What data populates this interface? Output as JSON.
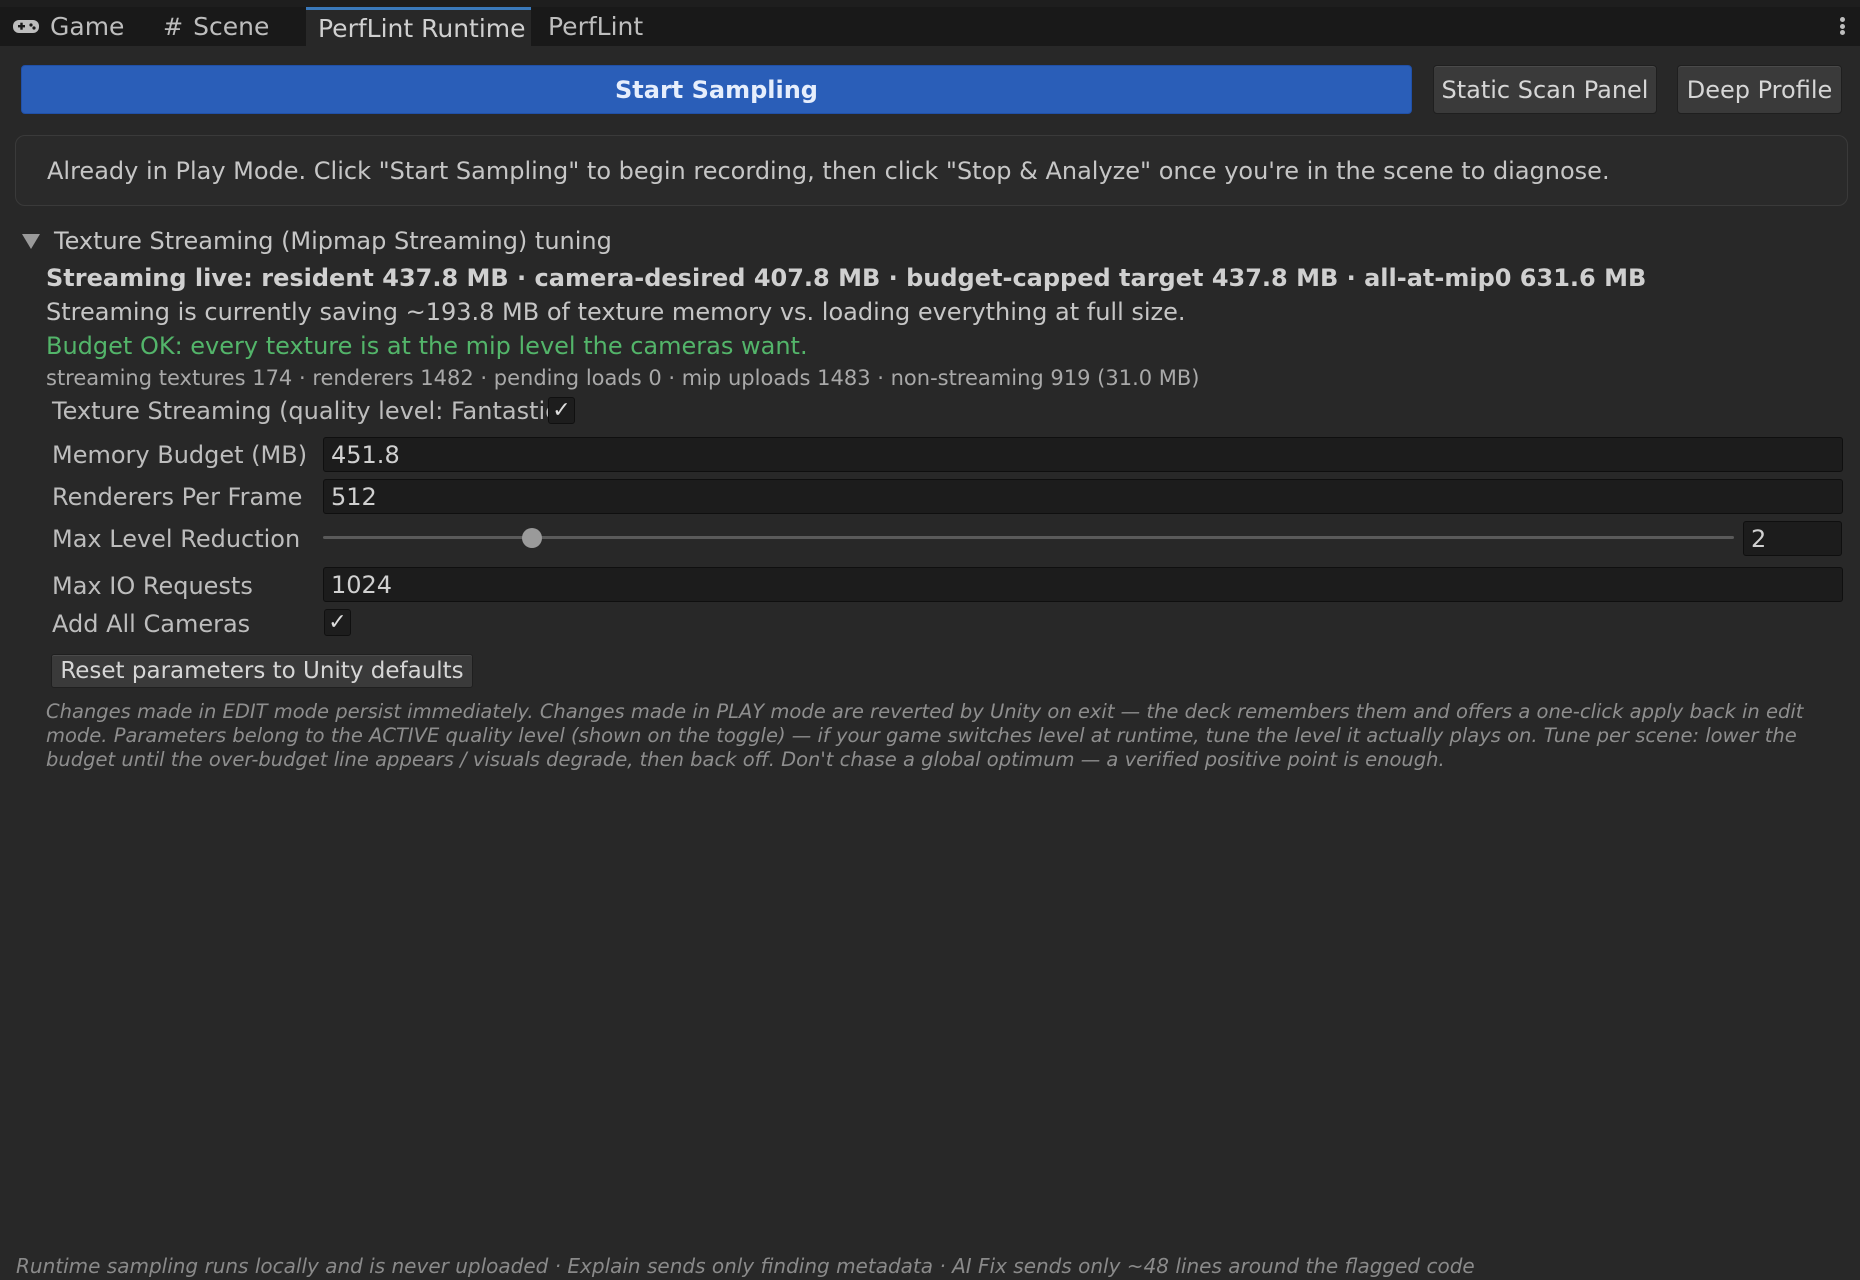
{
  "tabs": [
    {
      "label": "Game",
      "icon": "gamepad-icon"
    },
    {
      "label": "Scene",
      "icon": "hash-icon"
    },
    {
      "label": "PerfLint Runtime",
      "active": true
    },
    {
      "label": "PerfLint"
    }
  ],
  "toolbar": {
    "start_label": "Start Sampling",
    "static_scan_label": "Static Scan Panel",
    "deep_profile_label": "Deep Profile"
  },
  "help_text": "Already in Play Mode. Click \"Start Sampling\" to begin recording, then click \"Stop & Analyze\" once you're in the scene to diagnose.",
  "section": {
    "title": "Texture Streaming (Mipmap Streaming) tuning",
    "live_line": "Streaming live: resident 437.8 MB · camera-desired 407.8 MB · budget-capped target 437.8 MB · all-at-mip0 631.6 MB",
    "saving_line": "Streaming is currently saving ~193.8 MB of texture memory vs. loading everything at full size.",
    "budget_line": "Budget OK: every texture is at the mip level the cameras want.",
    "stats_line": "streaming textures 174 · renderers 1482 · pending loads 0 · mip uploads 1483 · non-streaming 919 (31.0 MB)",
    "streaming_toggle_label": "Texture Streaming (quality level: Fantastic)",
    "streaming_toggle_checked": true,
    "fields": {
      "memory_budget_label": "Memory Budget (MB)",
      "memory_budget_value": "451.8",
      "renderers_label": "Renderers Per Frame",
      "renderers_value": "512",
      "max_level_label": "Max Level Reduction",
      "max_level_value": "2",
      "max_level_fraction": 0.148,
      "max_io_label": "Max IO Requests",
      "max_io_value": "1024",
      "add_cameras_label": "Add All Cameras",
      "add_cameras_checked": true
    },
    "reset_label": "Reset parameters to Unity defaults",
    "note": "Changes made in EDIT mode persist immediately. Changes made in PLAY mode are reverted by Unity on exit — the deck remembers them and offers a one-click apply back in edit mode. Parameters belong to the ACTIVE quality level (shown on the toggle) — if your game switches level at runtime, tune the level it actually plays on. Tune per scene: lower the budget until the over-budget line appears / visuals degrade, then back off. Don't chase a global optimum — a verified positive point is enough."
  },
  "footer": "Runtime sampling runs locally and is never uploaded · Explain sends only finding metadata · AI Fix sends only ~48 lines around the flagged code",
  "colors": {
    "accent": "#2a5eb8",
    "tab_highlight": "#3a79bb",
    "ok_green": "#53b56a",
    "background": "#282828"
  }
}
